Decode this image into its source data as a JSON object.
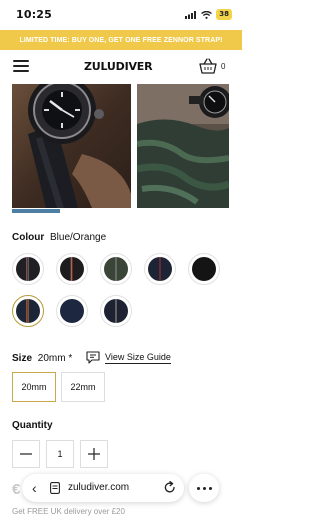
{
  "status_bar": {
    "time": "10:25",
    "battery": "38"
  },
  "promo": {
    "text": "LIMITED TIME: BUY ONE, GET ONE FREE ZENNOR STRAP!"
  },
  "header": {
    "logo": "ZULUDIVER",
    "cart_count": "0"
  },
  "gallery": {
    "progress_fraction": 0.22
  },
  "colour": {
    "label": "Colour",
    "selected": "Blue/Orange",
    "swatches": [
      {
        "name": "black-grey-red",
        "bg": "#1f1f24",
        "stripes": [
          "#9b9b9b",
          "#b03a3a",
          "#9b9b9b"
        ]
      },
      {
        "name": "black-red-cream",
        "bg": "#1d1d20",
        "stripes": [
          "#b3332c",
          "#e7d7b2",
          "#b3332c"
        ]
      },
      {
        "name": "olive-grey",
        "bg": "#3a4437",
        "stripes": [
          "#8c8f8a",
          "#8c8f8a"
        ]
      },
      {
        "name": "navy-red",
        "bg": "#1d2436",
        "stripes": [
          "#b4302f",
          "#b4302f"
        ]
      },
      {
        "name": "black",
        "bg": "#141414",
        "stripes": []
      },
      {
        "name": "blue-orange",
        "bg": "#1c2638",
        "stripes": [
          "#d9863b",
          "#e24f1f",
          "#d9863b"
        ]
      },
      {
        "name": "navy",
        "bg": "#1e2740",
        "stripes": []
      },
      {
        "name": "navy-grey",
        "bg": "#1d2332",
        "stripes": [
          "#a19c8c",
          "#a19c8c"
        ]
      }
    ]
  },
  "size": {
    "label": "Size",
    "selected": "20mm *",
    "guide_label": "View Size Guide",
    "options": [
      "20mm",
      "22mm"
    ]
  },
  "quantity": {
    "label": "Quantity",
    "value": "1",
    "minus": "−",
    "plus": "+"
  },
  "price": {
    "partial": "€"
  },
  "delivery": {
    "text": "Get FREE UK delivery over £20"
  },
  "browser": {
    "url": "zuludiver.com",
    "back": "‹"
  }
}
